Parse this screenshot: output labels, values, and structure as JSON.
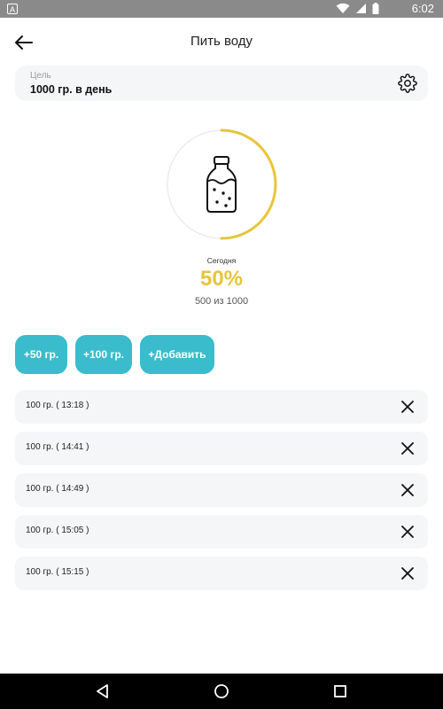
{
  "status_bar": {
    "time": "6:02",
    "app_indicator": "A",
    "icons": [
      "wifi-icon",
      "signal-icon",
      "battery-icon"
    ]
  },
  "header": {
    "title": "Пить воду",
    "back_icon": "arrow-left-icon"
  },
  "goal": {
    "label": "Цель",
    "value": "1000 гр. в день",
    "settings_icon": "gear-icon"
  },
  "progress": {
    "today_label": "Сегодня",
    "percent_text": "50%",
    "fraction": 0.5,
    "amount_text": "500 из 1000",
    "ring_color": "#e7c53a",
    "track_color": "#ececec",
    "center_icon": "bottle-icon"
  },
  "quick_add": [
    {
      "label": "+50 гр."
    },
    {
      "label": "+100 гр."
    },
    {
      "label": "+Добавить"
    }
  ],
  "log": [
    {
      "text": "100 гр. ( 13:18 )"
    },
    {
      "text": "100 гр. ( 14:41 )"
    },
    {
      "text": "100 гр. ( 14:49 )"
    },
    {
      "text": "100 гр. ( 15:05 )"
    },
    {
      "text": "100 гр. ( 15:15 )"
    }
  ],
  "colors": {
    "accent": "#3bbccd",
    "progress": "#e7c53a",
    "card_bg": "#f5f6f8"
  },
  "nav": [
    "back-nav-icon",
    "home-nav-icon",
    "recents-nav-icon"
  ]
}
